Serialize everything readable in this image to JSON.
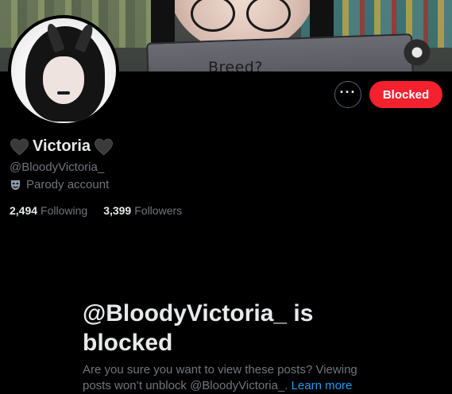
{
  "banner": {
    "sign_text": "Breed?"
  },
  "profile": {
    "display_name": "Victoria",
    "name_emoji": "black-heart-icon",
    "handle": "@BloodyVictoria_",
    "label": "Parody account",
    "label_icon": "theater-mask-icon",
    "following_count": "2,494",
    "following_label": "Following",
    "followers_count": "3,399",
    "followers_label": "Followers"
  },
  "actions": {
    "more_label": "···",
    "blocked_label": "Blocked",
    "blocked_color": "#f4212e"
  },
  "blocked_notice": {
    "title": "@BloodyVictoria_ is blocked",
    "description": "Are you sure you want to view these posts? Viewing posts won’t unblock @BloodyVictoria_.",
    "learn_more": "Learn more",
    "link_color": "#1d9bf0"
  }
}
